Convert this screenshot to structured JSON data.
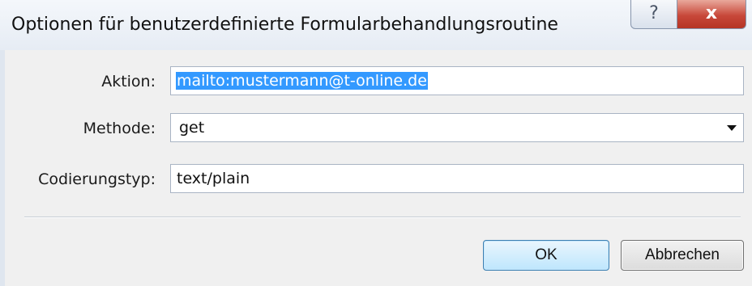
{
  "window": {
    "title": "Optionen für benutzerdefinierte Formularbehandlungsroutine",
    "help_glyph": "?",
    "close_glyph": "x"
  },
  "form": {
    "action_label": "Aktion:",
    "action_value": "mailto:mustermann@t-online.de",
    "method_label": "Methode:",
    "method_value": "get",
    "encoding_label": "Codierungstyp:",
    "encoding_value": "text/plain"
  },
  "buttons": {
    "ok_label": "OK",
    "cancel_label": "Abbrechen"
  },
  "colors": {
    "selection": "#3399ff",
    "close_button": "#c8483a"
  },
  "icons": {
    "help": "question-mark",
    "close": "x",
    "dropdown": "triangle-down"
  }
}
